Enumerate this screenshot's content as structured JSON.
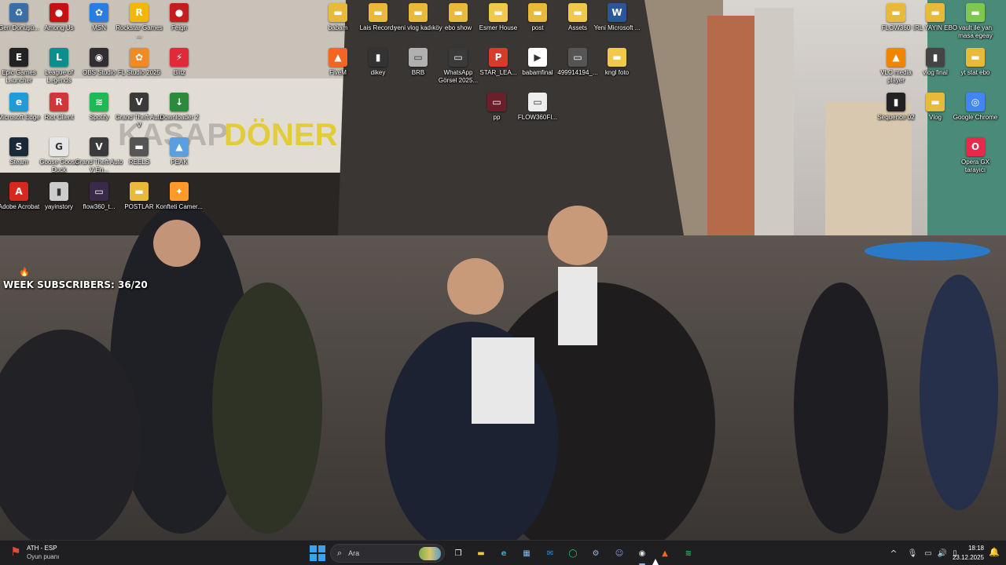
{
  "desktop": {
    "icons": [
      {
        "label": "Geri Dönüşü...",
        "icon": "recycle-bin-icon",
        "color": "#3a6ea5",
        "glyph": "♻"
      },
      {
        "label": "Among Us",
        "icon": "among-us-icon",
        "color": "#c51111",
        "glyph": "●"
      },
      {
        "label": "MSN",
        "icon": "msn-icon",
        "color": "#2a7de1",
        "glyph": "✿"
      },
      {
        "label": "Rockstar Games ...",
        "icon": "rockstar-icon",
        "color": "#f2b705",
        "glyph": "R"
      },
      {
        "label": "Feign",
        "icon": "feign-icon",
        "color": "#c41e1e",
        "glyph": "●"
      },
      {
        "label": "babam",
        "icon": "folder-icon",
        "color": "#e9b93a",
        "glyph": "▬"
      },
      {
        "label": "Lais Records",
        "icon": "folder-icon",
        "color": "#e9b93a",
        "glyph": "▬"
      },
      {
        "label": "yeni vlog kadıköy",
        "icon": "folder-icon",
        "color": "#e9b93a",
        "glyph": "▬"
      },
      {
        "label": "ebo show",
        "icon": "folder-icon",
        "color": "#e9b93a",
        "glyph": "▬"
      },
      {
        "label": "Esmer House",
        "icon": "folder-icon",
        "color": "#f0c84a",
        "glyph": "▬"
      },
      {
        "label": "post",
        "icon": "folder-icon",
        "color": "#e9b93a",
        "glyph": "▬"
      },
      {
        "label": "Assets",
        "icon": "folder-icon",
        "color": "#f0c84a",
        "glyph": "▬"
      },
      {
        "label": "Yeni Microsoft ...",
        "icon": "word-document-icon",
        "color": "#2b5797",
        "glyph": "W"
      },
      {
        "label": "FLOW360",
        "icon": "folder-icon",
        "color": "#e9b93a",
        "glyph": "▬"
      },
      {
        "label": "İRL YAYIN EBO",
        "icon": "folder-icon",
        "color": "#e9b93a",
        "glyph": "▬"
      },
      {
        "label": "vault ile yan masa egeay",
        "icon": "folder-icon",
        "color": "#7ec850",
        "glyph": "▬"
      },
      {
        "label": "Epic Games Launcher",
        "icon": "epic-games-icon",
        "color": "#222222",
        "glyph": "E"
      },
      {
        "label": "League of Legends",
        "icon": "league-of-legends-icon",
        "color": "#0a8f8f",
        "glyph": "L"
      },
      {
        "label": "OBS Studio",
        "icon": "obs-studio-icon",
        "color": "#302e31",
        "glyph": "◉"
      },
      {
        "label": "FL Studio 2025",
        "icon": "fl-studio-icon",
        "color": "#f08a24",
        "glyph": "✿"
      },
      {
        "label": "Blitz",
        "icon": "blitz-icon",
        "color": "#e02a3a",
        "glyph": "⚡"
      },
      {
        "label": "FiveM",
        "icon": "fivem-icon",
        "color": "#f26522",
        "glyph": "▲"
      },
      {
        "label": "dikey",
        "icon": "video-file-icon",
        "color": "#333333",
        "glyph": "▮"
      },
      {
        "label": "BRB",
        "icon": "image-file-icon",
        "color": "#b0b0b0",
        "glyph": "▭"
      },
      {
        "label": "WhatsApp Görsel 2025...",
        "icon": "image-file-icon",
        "color": "#3a3a3a",
        "glyph": "▭"
      },
      {
        "label": "STAR_LEA...",
        "icon": "pdf-file-icon",
        "color": "#d83b2b",
        "glyph": "P"
      },
      {
        "label": "babamfinal",
        "icon": "video-file-icon",
        "color": "#ffffff",
        "glyph": "▶"
      },
      {
        "label": "499914194_...",
        "icon": "image-file-icon",
        "color": "#555555",
        "glyph": "▭"
      },
      {
        "label": "kngl foto",
        "icon": "folder-icon",
        "color": "#f0c84a",
        "glyph": "▬"
      },
      {
        "label": "VLC media player",
        "icon": "vlc-icon",
        "color": "#f28500",
        "glyph": "▲"
      },
      {
        "label": "vlog final",
        "icon": "video-file-icon",
        "color": "#444444",
        "glyph": "▮"
      },
      {
        "label": "yt stat ebo",
        "icon": "folder-icon",
        "color": "#e9b93a",
        "glyph": "▬"
      },
      {
        "label": "Microsoft Edge",
        "icon": "edge-icon",
        "color": "#1f9cd8",
        "glyph": "e"
      },
      {
        "label": "Riot Client",
        "icon": "riot-client-icon",
        "color": "#d13639",
        "glyph": "R"
      },
      {
        "label": "Spotify",
        "icon": "spotify-icon",
        "color": "#1db954",
        "glyph": "≋"
      },
      {
        "label": "Grand Theft Auto V",
        "icon": "gta-icon",
        "color": "#3a3a3a",
        "glyph": "V"
      },
      {
        "label": "Downloader 2",
        "icon": "downloader-icon",
        "color": "#2c8a3c",
        "glyph": "↓"
      },
      {
        "label": "pp",
        "icon": "image-file-icon",
        "color": "#6a1f2a",
        "glyph": "▭"
      },
      {
        "label": "FLOW360FI...",
        "icon": "image-file-icon",
        "color": "#eeeeee",
        "glyph": "▭"
      },
      {
        "label": "Sequence 02",
        "icon": "video-file-icon",
        "color": "#222222",
        "glyph": "▮"
      },
      {
        "label": "Vlog",
        "icon": "folder-icon",
        "color": "#e9b93a",
        "glyph": "▬"
      },
      {
        "label": "Google Chrome",
        "icon": "chrome-icon",
        "color": "#4285f4",
        "glyph": "◎"
      },
      {
        "label": "Steam",
        "icon": "steam-icon",
        "color": "#1b2838",
        "glyph": "S"
      },
      {
        "label": "Goose Goose Duck",
        "icon": "goose-goose-duck-icon",
        "color": "#e6e6e6",
        "glyph": "G"
      },
      {
        "label": "Grand Theft Auto V En...",
        "icon": "gta-icon",
        "color": "#3a3a3a",
        "glyph": "V"
      },
      {
        "label": "REELS",
        "icon": "folder-icon",
        "color": "#555555",
        "glyph": "▬"
      },
      {
        "label": "PEAK",
        "icon": "peak-icon",
        "color": "#5aa0e0",
        "glyph": "▲"
      },
      {
        "label": "Opera GX tarayıcı",
        "icon": "opera-gx-icon",
        "color": "#e8294a",
        "glyph": "O"
      },
      {
        "label": "Adobe Acrobat",
        "icon": "adobe-acrobat-icon",
        "color": "#d6281e",
        "glyph": "A"
      },
      {
        "label": "yayinstory",
        "icon": "video-file-icon",
        "color": "#cccccc",
        "glyph": "▮"
      },
      {
        "label": "flow360_t...",
        "icon": "image-file-icon",
        "color": "#3a2a4a",
        "glyph": "▭"
      },
      {
        "label": "POSTLAR",
        "icon": "folder-icon",
        "color": "#e9b93a",
        "glyph": "▬"
      },
      {
        "label": "Konfteti Camer...",
        "icon": "camera-app-icon",
        "color": "#ff9a2a",
        "glyph": "✦"
      }
    ],
    "overlay_text": "WEEK SUBSCRIBERS: 36/20"
  },
  "taskbar": {
    "weather_title": "ATH - ESP",
    "weather_subtitle": "Oyun puanı",
    "search_placeholder": "Ara",
    "apps": [
      {
        "name": "task-view",
        "icon": "task-view-icon",
        "bg": "transparent",
        "glyph": "❐",
        "fg": "#ffffff",
        "active": false
      },
      {
        "name": "file-explorer",
        "icon": "folder-icon",
        "bg": "transparent",
        "glyph": "▬",
        "fg": "#f0c84a",
        "active": false
      },
      {
        "name": "edge",
        "icon": "edge-icon",
        "bg": "transparent",
        "glyph": "e",
        "fg": "#2ea7e0",
        "active": false
      },
      {
        "name": "microsoft-store",
        "icon": "store-icon",
        "bg": "transparent",
        "glyph": "▦",
        "fg": "#7fb8f0",
        "active": false
      },
      {
        "name": "outlook",
        "icon": "outlook-icon",
        "bg": "transparent",
        "glyph": "✉",
        "fg": "#2f8fe0",
        "active": false
      },
      {
        "name": "whatsapp",
        "icon": "whatsapp-icon",
        "bg": "transparent",
        "glyph": "◯",
        "fg": "#25d366",
        "active": false
      },
      {
        "name": "settings-app",
        "icon": "gear-icon",
        "bg": "transparent",
        "glyph": "⚙",
        "fg": "#9ab8d8",
        "active": false
      },
      {
        "name": "discord",
        "icon": "discord-icon",
        "bg": "transparent",
        "glyph": "☺",
        "fg": "#8a9cf0",
        "active": false
      },
      {
        "name": "obs-studio",
        "icon": "obs-studio-icon",
        "bg": "transparent",
        "glyph": "◉",
        "fg": "#e0e0e0",
        "active": true
      },
      {
        "name": "fivem",
        "icon": "fivem-icon",
        "bg": "transparent",
        "glyph": "▲",
        "fg": "#f26522",
        "active": false
      },
      {
        "name": "spotify",
        "icon": "spotify-icon",
        "bg": "transparent",
        "glyph": "≋",
        "fg": "#1db954",
        "active": false
      }
    ],
    "tray": {
      "chevron": "^",
      "mic": "🎙",
      "network": "▭",
      "volume": "🔊",
      "battery": "▯"
    },
    "time": "18:18",
    "date": "23.12.2025"
  }
}
